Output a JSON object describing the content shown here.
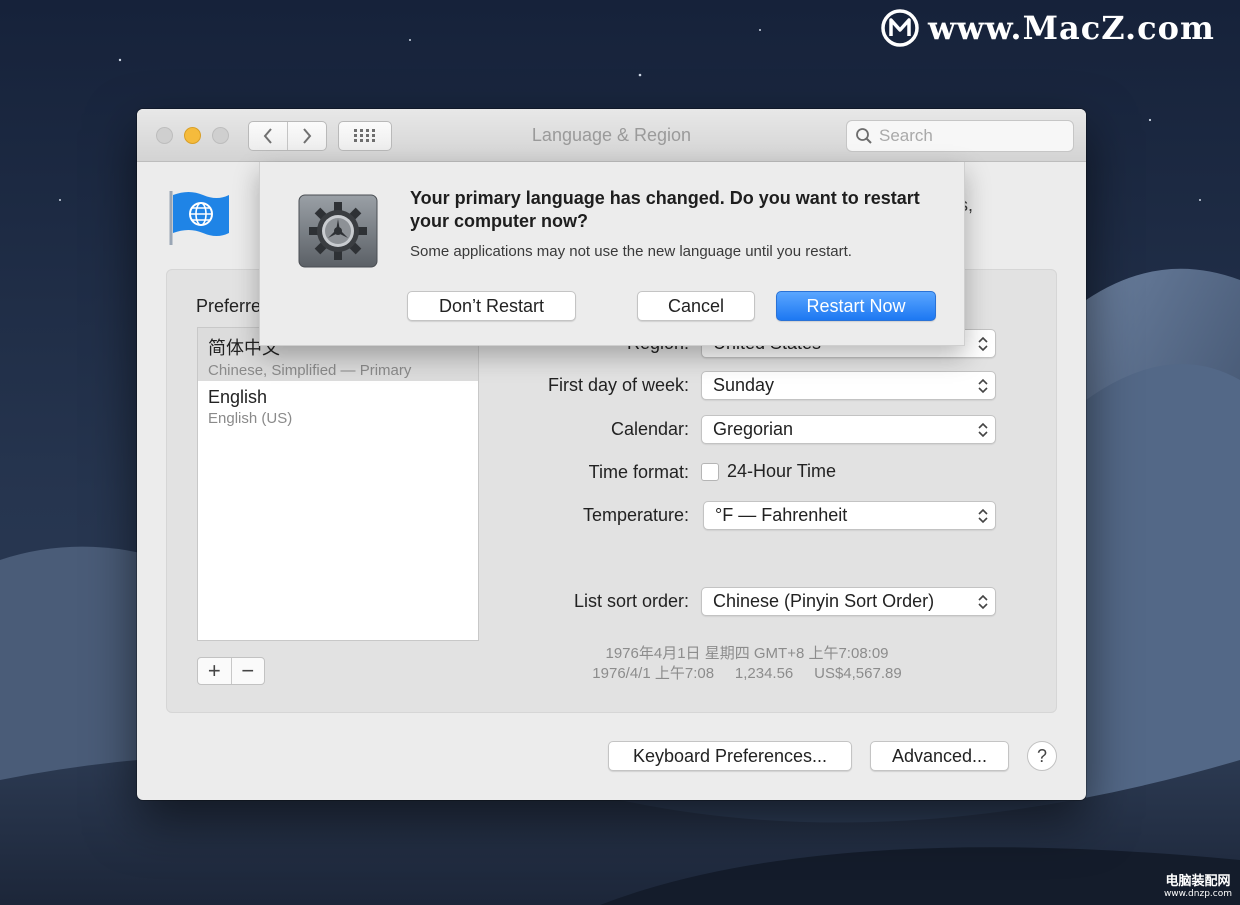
{
  "watermark": {
    "brand": "www.MacZ.com",
    "corner_cn": "电脑装配网",
    "corner_url": "www.dnzp.com"
  },
  "window": {
    "title": "Language & Region",
    "search": {
      "placeholder": "Search",
      "value": ""
    },
    "obscured_text": "s,"
  },
  "dialog": {
    "heading": "Your primary language has changed. Do you want to restart your computer now?",
    "message": "Some applications may not use the new language until you restart.",
    "buttons": {
      "dont_restart": "Don’t Restart",
      "cancel": "Cancel",
      "restart_now": "Restart Now"
    },
    "accent_color": "#1d78f2"
  },
  "preferred": {
    "label": "Preferred languages:",
    "languages": [
      {
        "name": "简体中文",
        "sub": "Chinese, Simplified — Primary",
        "selected": true
      },
      {
        "name": "English",
        "sub": "English (US)",
        "selected": false
      }
    ],
    "add_label": "+",
    "remove_label": "−"
  },
  "settings": {
    "region": {
      "label": "Region:",
      "value": "United States"
    },
    "first_day": {
      "label": "First day of week:",
      "value": "Sunday"
    },
    "calendar": {
      "label": "Calendar:",
      "value": "Gregorian"
    },
    "time_format": {
      "label": "Time format:",
      "checkbox_label": "24-Hour Time",
      "checked": false
    },
    "temperature": {
      "label": "Temperature:",
      "value": "°F — Fahrenheit"
    },
    "sort_order": {
      "label": "List sort order:",
      "value": "Chinese (Pinyin Sort Order)"
    }
  },
  "sample": {
    "line1": "1976年4月1日 星期四 GMT+8 上午7:08:09",
    "line2": "1976/4/1 上午7:08     1,234.56     US$4,567.89"
  },
  "footer": {
    "keyboard": "Keyboard Preferences...",
    "advanced": "Advanced...",
    "help": "?"
  },
  "icons": {
    "language_region": "blue-flag-globe-icon",
    "system_prefs": "gear-icon",
    "search": "search-icon",
    "back": "chevron-left-icon",
    "forward": "chevron-right-icon",
    "grid": "grid-icon"
  }
}
